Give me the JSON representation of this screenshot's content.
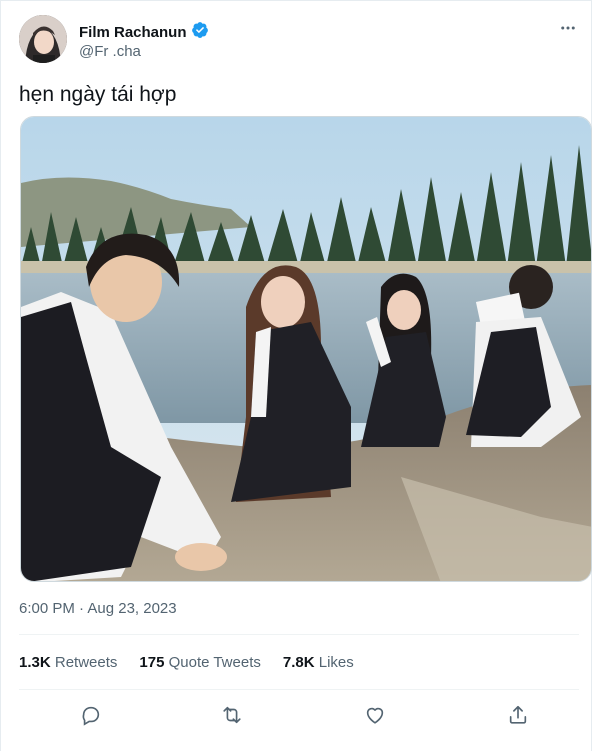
{
  "tweet": {
    "author": {
      "display_name": "Film Rachanun",
      "handle": "@Fr .cha",
      "verified": true
    },
    "text": "hẹn ngày tái hợp",
    "timestamp": "6:00 PM · Aug 23, 2023",
    "stats": [
      {
        "value": "1.3K",
        "label": "Retweets"
      },
      {
        "value": "175",
        "label": "Quote Tweets"
      },
      {
        "value": "7.8K",
        "label": "Likes"
      }
    ]
  },
  "icons": {
    "more": "more-horizontal-icon",
    "reply": "reply-icon",
    "retweet": "retweet-icon",
    "like": "heart-icon",
    "share": "share-icon",
    "verified": "verified-badge-icon"
  },
  "colors": {
    "text_primary": "#0f1419",
    "text_secondary": "#536471",
    "verified_blue": "#1d9bf0",
    "divider": "#eff3f4"
  }
}
